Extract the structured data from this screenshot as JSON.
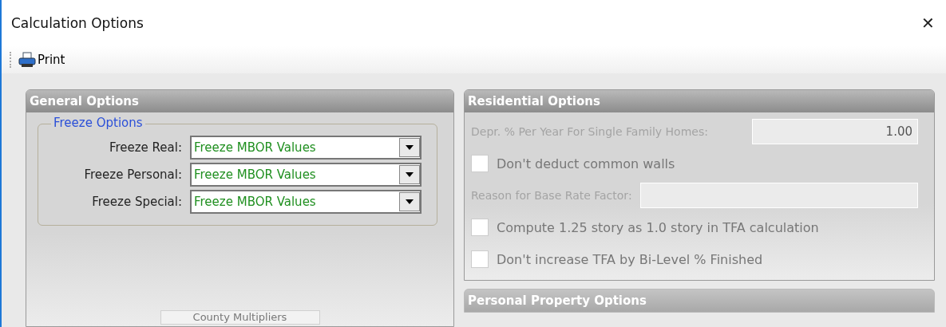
{
  "window": {
    "title": "Calculation Options",
    "close": "✕"
  },
  "toolbar": {
    "items": [
      {
        "label": "Print"
      }
    ]
  },
  "general_options": {
    "title": "General Options",
    "freeze_options": {
      "title": "Freeze Options",
      "rows": [
        {
          "label": "Freeze Real:",
          "value": "Freeze MBOR Values"
        },
        {
          "label": "Freeze Personal:",
          "value": "Freeze MBOR Values"
        },
        {
          "label": "Freeze Special:",
          "value": "Freeze MBOR Values"
        }
      ]
    },
    "button": "County Multipliers"
  },
  "residential_options": {
    "title": "Residential Options",
    "disabled": true,
    "items": [
      {
        "kind": "field",
        "label": "Depr. % Per Year For Single Family Homes:",
        "value": "1.00"
      },
      {
        "kind": "checkbox",
        "label": "Don't deduct common walls",
        "checked": false
      },
      {
        "kind": "field",
        "label": "Reason for Base Rate Factor:"
      },
      {
        "kind": "checkbox",
        "label": "Compute 1.25 story as 1.0 story in TFA calculation",
        "checked": false
      },
      {
        "kind": "checkbox",
        "label": "Don't increase TFA by Bi-Level % Finished",
        "checked": false
      }
    ]
  },
  "personal_property_options": {
    "title": "Personal Property Options"
  }
}
